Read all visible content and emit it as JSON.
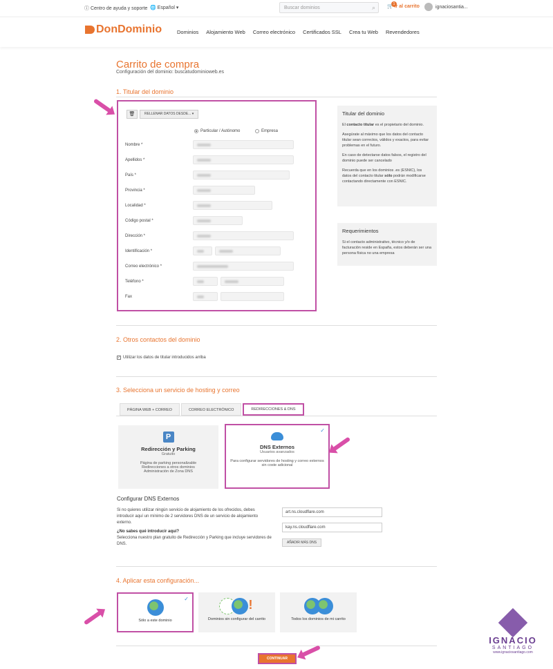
{
  "topbar": {
    "help": "Centro de ayuda y soporte",
    "language": "Español",
    "search_placeholder": "Buscar dominios",
    "cart_label": "Ir al carrito",
    "cart_count": "1",
    "user": "ignaciosantia..."
  },
  "nav": {
    "logo": "DonDominio",
    "links": [
      "Dominios",
      "Alojamiento Web",
      "Correo electrónico",
      "Certificados SSL",
      "Crea tu Web",
      "Revendedores"
    ]
  },
  "page": {
    "title": "Carrito de compra",
    "subtitle": "Configuración del dominio: buscatudominioweb.es"
  },
  "section1": {
    "title": "1. Titular del dominio",
    "fill_button": "RELLENAR DATOS DESDE...",
    "radio_personal": "Particular / Autónomo",
    "radio_company": "Empresa",
    "fields": [
      "Nombre",
      "Apellidos",
      "País",
      "Provincia",
      "Localidad",
      "Código postal",
      "Dirección",
      "Identificación",
      "Correo electrónico",
      "Teléfono",
      "Fax"
    ]
  },
  "side1": {
    "title": "Titular del dominio",
    "p1_prefix": "El",
    "p1_bold": "contacto titular",
    "p1_suffix": "es el propietario del dominio.",
    "p2": "Asegúrate al máximo que los datos del contacto titular sean correctos, válidos y exactos, para evitar problemas en el futuro.",
    "p3": "En caso de detectarse datos falsos, el registro del dominio puede ser cancelado",
    "p4_prefix": "Recuerda que en los dominios .es (ESNIC), los datos del contacto titular",
    "p4_bold": "sólo",
    "p4_suffix": "podrán modificarse contactando directamente con ESNIC."
  },
  "side2": {
    "title": "Requerimientos",
    "text": "Si el contacto administrativo, técnico y/o de facturación reside en España, estos deberán ser una persona física no una empresa"
  },
  "section2": {
    "title": "2. Otros contactos del dominio",
    "checkbox_label": "Utilizar los datos de titular introducidos arriba"
  },
  "section3": {
    "title": "3. Selecciona un servicio de hosting y correo",
    "tabs": [
      "PÁGINA WEB + CORREO",
      "CORREO ELECTRÓNICO",
      "REDIRECCIONES & DNS"
    ],
    "card1": {
      "title": "Redirección y Parking",
      "sub": "Gratuito",
      "lines": [
        "Página de parking personalizable",
        "Redirecciones a otros dominios",
        "Administración de Zona DNS"
      ]
    },
    "card2": {
      "title": "DNS Externos",
      "sub": "Usuarios avanzados",
      "lines": [
        "Para configurar servidores de hosting y correo externos",
        "sin coste adicional"
      ]
    },
    "dns_title": "Configurar DNS Externos",
    "dns_text": "Si no quieres utilizar ningún servicio de alojamiento de los ofrecidos, debes introducir aquí un mínimo de 2 servidores DNS de un servicio de alojamiento externo.",
    "dns_help_title": "¿No sabes qué introducir aquí?",
    "dns_help_text": "Selecciona nuestro plan gratuito de Redirección y Parking que incluye servidores de DNS.",
    "dns1": "art.ns.cloudflare.com",
    "dns2": "kay.ns.cloudflare.com",
    "add_button": "AÑADIR MÁS DNS"
  },
  "section4": {
    "title": "4. Aplicar esta configuración...",
    "options": [
      "Sólo a este dominio",
      "Dominios sin configurar del carrito",
      "Todos los dominios de mi carrito"
    ],
    "continue": "CONTINUAR"
  },
  "watermark": {
    "first": "IGNACIO",
    "last": "SANTIAGO",
    "url": "www.ignaciosantiago.com"
  }
}
